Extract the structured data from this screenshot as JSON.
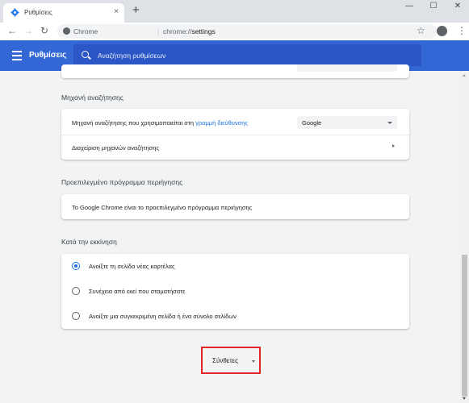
{
  "tab": {
    "title": "Ρυθμίσεις",
    "icon": "gear-icon",
    "close": "×"
  },
  "window": {
    "new_tab": "+",
    "minimize": "—",
    "maximize": "☐",
    "close": "✕"
  },
  "toolbar": {
    "back": "←",
    "forward": "→",
    "reload": "↻",
    "site_label": "Chrome",
    "separator": "|",
    "url_scheme": "chrome://",
    "url_path": "settings",
    "star": "☆",
    "menu": "⋮"
  },
  "header": {
    "title": "Ρυθμίσεις",
    "search_placeholder": "Αναζήτηση ρυθμίσεων",
    "accent": "#3367d6"
  },
  "search_engine": {
    "section_title": "Μηχανή αναζήτησης",
    "row1_text": "Μηχανή αναζήτησης που χρησιμοποιείται στη",
    "row1_link": "γραμμή διεύθυνσης",
    "dropdown_value": "Google",
    "row2_text": "Διαχείριση μηχανών αναζήτησης"
  },
  "default_browser": {
    "section_title": "Προεπιλεγμένο πρόγραμμα περιήγησης",
    "row_text": "Το Google Chrome είναι το προεπιλεγμένο πρόγραμμα περιήγησης"
  },
  "startup": {
    "section_title": "Κατά την εκκίνηση",
    "options": [
      {
        "label": "Ανοίξτε τη σελίδα νέας καρτέλας",
        "checked": true
      },
      {
        "label": "Συνέχεια από εκεί που σταματήσατε",
        "checked": false
      },
      {
        "label": "Ανοίξτε μια συγκεκριμένη σελίδα ή ένα σύνολο σελίδων",
        "checked": false
      }
    ]
  },
  "advanced": {
    "label": "Σύνθετες",
    "highlight_color": "#e0252b"
  }
}
